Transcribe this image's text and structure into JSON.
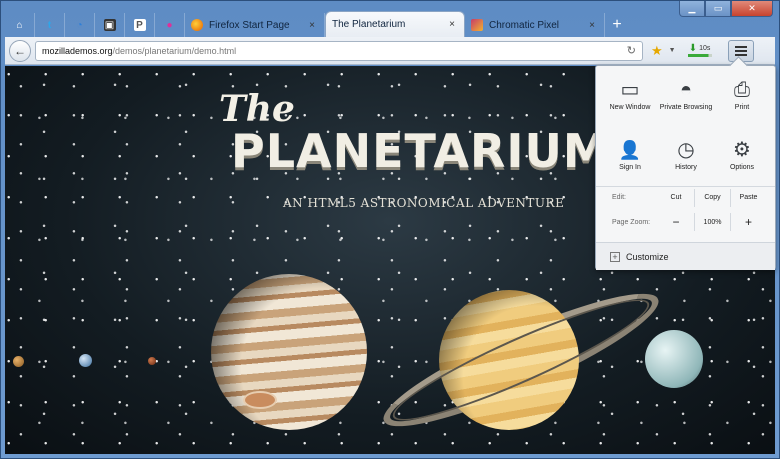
{
  "window": {
    "controls": {
      "minimize": "▁",
      "maximize": "▭",
      "close": "✕"
    }
  },
  "app_tabs": [
    {
      "icon": "home-icon",
      "glyph": "⌂",
      "color": "#3a6ea5"
    },
    {
      "icon": "twitter-icon",
      "glyph": "t",
      "color": "#2fa6e8"
    },
    {
      "icon": "circle-logo-icon",
      "glyph": "◔",
      "color": "#2d7fd8"
    },
    {
      "icon": "puzzle-icon",
      "glyph": "▣",
      "color": "#333"
    },
    {
      "icon": "pocket-icon",
      "glyph": "P",
      "color": "#555"
    },
    {
      "icon": "flickr-icon",
      "glyph": "●",
      "color": "#e0309a"
    }
  ],
  "tabs": [
    {
      "label": "Firefox Start Page",
      "favicon_color": "#e66000",
      "active": false
    },
    {
      "label": "The Planetarium",
      "favicon_color": "",
      "active": true
    },
    {
      "label": "Chromatic Pixel",
      "favicon_color": "#c63c6a",
      "active": false
    }
  ],
  "tab_close_glyph": "×",
  "new_tab_glyph": "+",
  "navbar": {
    "back_glyph": "←",
    "url_host": "mozillademos.org",
    "url_path": "/demos/planetarium/demo.html",
    "reload_glyph": "↻",
    "star_glyph": "★",
    "dropdown_glyph": "▼",
    "download_label": "10s",
    "download_progress": 0.85
  },
  "page": {
    "title_the": "The",
    "title_main": "PLANETARIUM",
    "subtitle": "AN HTML5 ASTRONOMICAL ADVENTURE"
  },
  "menu_panel": {
    "items": [
      {
        "name": "new-window",
        "label": "New Window",
        "icon": "window-icon",
        "glyph": "▭"
      },
      {
        "name": "private-browsing",
        "label": "Private Browsing",
        "icon": "mask-icon",
        "glyph": "◓"
      },
      {
        "name": "print",
        "label": "Print",
        "icon": "printer-icon",
        "glyph": "⎙"
      },
      {
        "name": "sign-in",
        "label": "Sign In",
        "icon": "person-icon",
        "glyph": "👤"
      },
      {
        "name": "history",
        "label": "History",
        "icon": "clock-icon",
        "glyph": "◷"
      },
      {
        "name": "options",
        "label": "Options",
        "icon": "gear-icon",
        "glyph": "⚙"
      }
    ],
    "edit": {
      "label": "Edit:",
      "cut": "Cut",
      "copy": "Copy",
      "paste": "Paste"
    },
    "zoom": {
      "label": "Page Zoom:",
      "minus": "−",
      "value": "100%",
      "plus": "+"
    },
    "customize": {
      "glyph": "+",
      "label": "Customize"
    }
  }
}
